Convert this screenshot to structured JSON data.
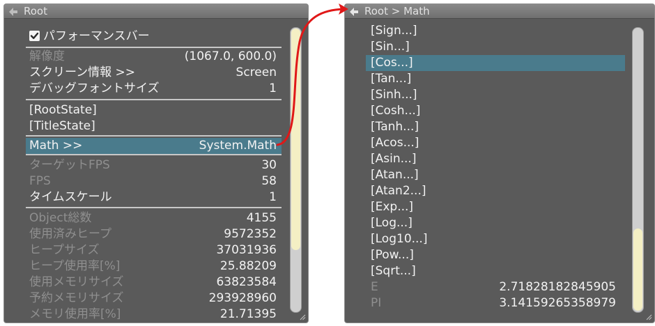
{
  "left_panel": {
    "title": "Root",
    "perf_bar": {
      "label": "パフォーマンスバー",
      "checked": true
    },
    "display": [
      {
        "label": "解像度",
        "value": "(1067.0, 600.0)",
        "dim": true
      },
      {
        "label": "スクリーン情報 >>",
        "value": "Screen",
        "dim": false
      },
      {
        "label": "デバッグフォントサイズ",
        "value": "1",
        "dim": false
      }
    ],
    "states": [
      {
        "label": "[RootState]"
      },
      {
        "label": "[TitleState]"
      }
    ],
    "math_row": {
      "label": "Math >>",
      "value": "System.Math"
    },
    "timing": [
      {
        "label": "ターゲットFPS",
        "value": "30",
        "dim": true
      },
      {
        "label": "FPS",
        "value": "58",
        "dim": true
      },
      {
        "label": "タイムスケール",
        "value": "1",
        "dim": false
      }
    ],
    "memory": [
      {
        "label": "Object総数",
        "value": "4155"
      },
      {
        "label": "使用済みヒープ",
        "value": "9572352"
      },
      {
        "label": "ヒープサイズ",
        "value": "37031936"
      },
      {
        "label": "ヒープ使用率[%]",
        "value": "25.88209"
      },
      {
        "label": "使用メモリサイズ",
        "value": "63823584"
      },
      {
        "label": "予約メモリサイズ",
        "value": "293928960"
      },
      {
        "label": "メモリ使用率[%]",
        "value": "21.71395"
      }
    ],
    "scroll_position": 0.0
  },
  "right_panel": {
    "title": "Root > Math",
    "functions": [
      "[Sign...]",
      "[Sin...]",
      "[Cos...]",
      "[Tan...]",
      "[Sinh...]",
      "[Cosh...]",
      "[Tanh...]",
      "[Acos...]",
      "[Asin...]",
      "[Atan...]",
      "[Atan2...]",
      "[Exp...]",
      "[Log...]",
      "[Log10...]",
      "[Pow...]",
      "[Sqrt...]"
    ],
    "selected_function": "[Cos...]",
    "constants": [
      {
        "label": "E",
        "value": "2.71828182845905"
      },
      {
        "label": "PI",
        "value": "3.14159265358979"
      }
    ],
    "scroll_position": 1.0
  },
  "colors": {
    "panel_bg": "#5a5a5a",
    "selection": "#4a7b8c",
    "scroll_thumb": "#f4efc4",
    "arrow": "#e01818"
  }
}
